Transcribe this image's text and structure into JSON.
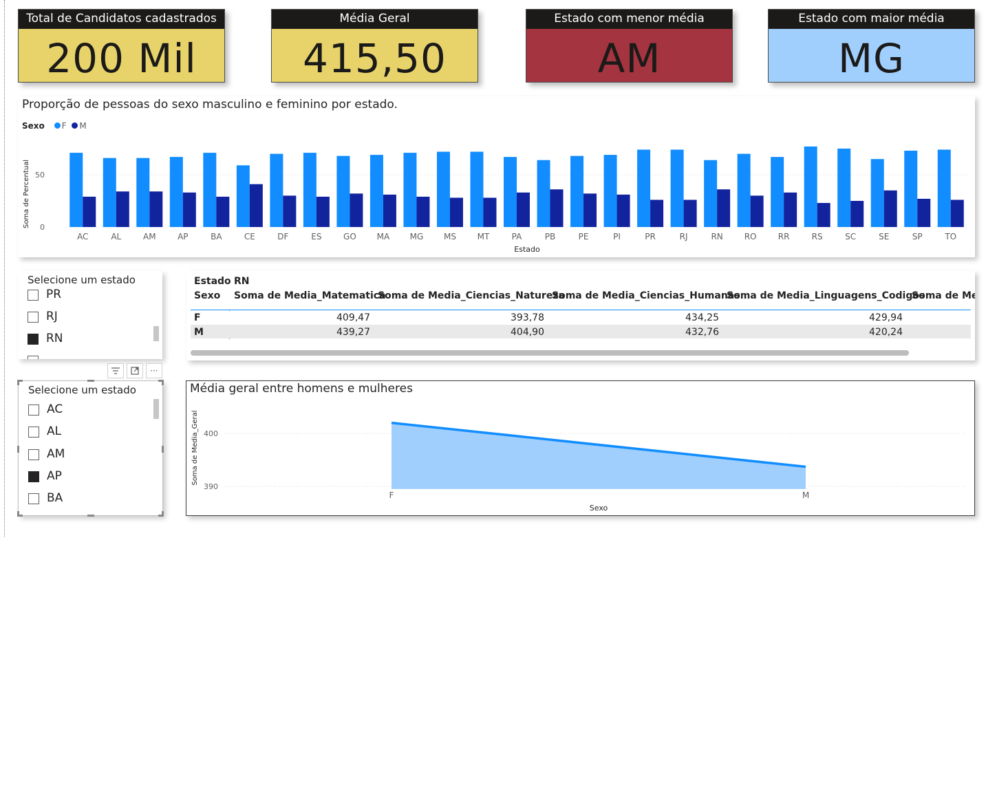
{
  "kpis": [
    {
      "title": "Total de Candidatos cadastrados",
      "value": "200 Mil",
      "bg": "#e8d36b"
    },
    {
      "title": "Média Geral",
      "value": "415,50",
      "bg": "#e8d36b"
    },
    {
      "title": "Estado com menor média",
      "value": "AM",
      "bg": "#a4343f"
    },
    {
      "title": "Estado com maior média",
      "value": "MG",
      "bg": "#a0cffe"
    }
  ],
  "bar_chart": {
    "title": "Proporção de pessoas do sexo masculino e feminino por estado.",
    "legend_title": "Sexo",
    "legend_f": "F",
    "legend_m": "M",
    "color_f": "#118dff",
    "color_m": "#12239e"
  },
  "slicer1": {
    "header": "Selecione um estado",
    "items": [
      {
        "label": "PR",
        "checked": false
      },
      {
        "label": "RJ",
        "checked": false
      },
      {
        "label": "RN",
        "checked": true
      }
    ]
  },
  "slicer2": {
    "header": "Selecione um estado",
    "items": [
      {
        "label": "AC",
        "checked": false
      },
      {
        "label": "AL",
        "checked": false
      },
      {
        "label": "AM",
        "checked": false
      },
      {
        "label": "AP",
        "checked": true
      },
      {
        "label": "BA",
        "checked": false
      }
    ]
  },
  "toolbar": {
    "filter_icon": "filter-icon",
    "focus_icon": "focus-mode-icon",
    "more_icon": "more-options-icon",
    "more_label": "···"
  },
  "table": {
    "row1_label": "Estado",
    "row1_value": "RN",
    "row2_label": "Sexo",
    "columns": [
      "Soma de Media_Matematica",
      "Soma de Media_Ciencias_Natureza",
      "Soma de Media_Ciencias_Humanas",
      "Soma de Media_Linguagens_Codigos",
      "Soma de Me"
    ],
    "rows": [
      {
        "label": "F",
        "values": [
          "409,47",
          "393,78",
          "434,25",
          "429,94"
        ]
      },
      {
        "label": "M",
        "values": [
          "439,27",
          "404,90",
          "432,76",
          "420,24"
        ]
      }
    ]
  },
  "area_chart": {
    "title": "Média geral entre homens e mulheres",
    "color": "#118dff",
    "fill": "#a0cffe"
  },
  "chart_data": [
    {
      "type": "bar",
      "title": "Proporção de pessoas do sexo masculino e feminino por estado.",
      "xlabel": "Estado",
      "ylabel": "Soma de Percentual",
      "categories": [
        "AC",
        "AL",
        "AM",
        "AP",
        "BA",
        "CE",
        "DF",
        "ES",
        "GO",
        "MA",
        "MG",
        "MS",
        "MT",
        "PA",
        "PB",
        "PE",
        "PI",
        "PR",
        "RJ",
        "RN",
        "RO",
        "RR",
        "RS",
        "SC",
        "SE",
        "SP",
        "TO"
      ],
      "series": [
        {
          "name": "F",
          "values": [
            71,
            66,
            66,
            67,
            71,
            59,
            70,
            71,
            68,
            69,
            71,
            72,
            72,
            67,
            64,
            68,
            69,
            74,
            74,
            64,
            70,
            67,
            77,
            75,
            65,
            73,
            74
          ]
        },
        {
          "name": "M",
          "values": [
            29,
            34,
            34,
            33,
            29,
            41,
            30,
            29,
            32,
            31,
            29,
            28,
            28,
            33,
            36,
            32,
            31,
            26,
            26,
            36,
            30,
            33,
            23,
            25,
            35,
            27,
            26
          ]
        }
      ],
      "yticks": [
        0,
        50
      ],
      "ylim": [
        0,
        85
      ],
      "legend": "top-left",
      "grid": true
    },
    {
      "type": "area",
      "title": "Média geral entre homens e mulheres",
      "xlabel": "Sexo",
      "ylabel": "Soma de Media_Geral",
      "categories": [
        "F",
        "M"
      ],
      "values": [
        402,
        393.7
      ],
      "yticks": [
        390,
        400
      ],
      "ylim": [
        389.5,
        403
      ],
      "grid": true
    }
  ]
}
